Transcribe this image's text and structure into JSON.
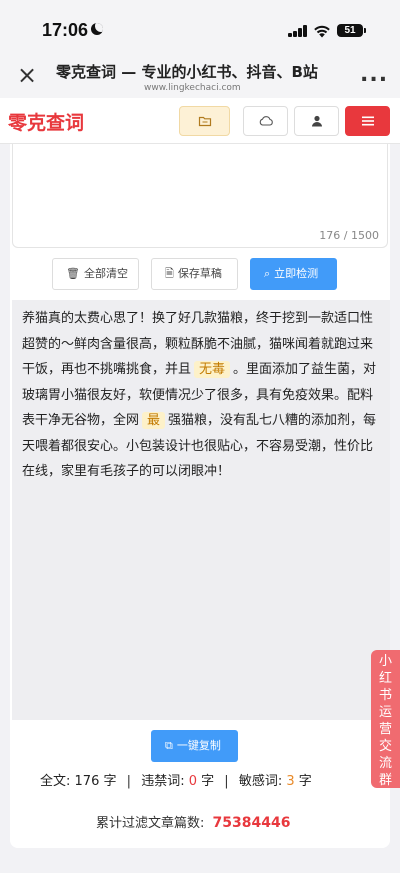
{
  "status": {
    "time": "17:06",
    "battery": "51"
  },
  "browser": {
    "title": "零克查词 — 专业的小红书、抖音、B站",
    "url": "www.lingkechaci.com",
    "more": "..."
  },
  "site": {
    "logo": "零克查词"
  },
  "editor": {
    "counter": "176 / 1500"
  },
  "actions": {
    "clear_label": "全部清空",
    "save_label": "保存草稿",
    "check_label": "立即检测"
  },
  "result": {
    "text_before_1": "养猫真的太费心思了！换了好几款猫粮，终于挖到一款适口性超赞的～鲜肉含量很高，颗粒酥脆不油腻，猫咪闻着就跑过来干饭，再也不挑嘴挑食，并且",
    "highlight_1": "无毒",
    "text_before_2": "。里面添加了益生菌，对玻璃胃小猫很友好，软便情况少了很多，具有免疫效果。配料表干净无谷物，全网",
    "highlight_2": "最",
    "text_after_2": "强猫粮，没有乱七八糟的添加剂，每天喂着都很安心。小包装设计也很贴心，不容易受潮，性价比在线，家里有毛孩子的可以闭眼冲！"
  },
  "bottom": {
    "copy_label": "一键复制",
    "stats": {
      "total_label": "全文:",
      "total_value": "176",
      "total_unit": "字",
      "banned_label": "违禁词:",
      "banned_value": "0",
      "banned_unit": "字",
      "sensitive_label": "敏感词:",
      "sensitive_value": "3",
      "sensitive_unit": "字"
    },
    "filtered_label": "累计过滤文章篇数:",
    "filtered_value": "75384446"
  },
  "side_tab": {
    "chars": [
      "小",
      "红",
      "书",
      "运",
      "营",
      "交",
      "流",
      "群"
    ]
  },
  "colors": {
    "brand_red": "#e8383d",
    "primary_blue": "#419bf9",
    "highlight_bg": "#fdf1c9"
  }
}
